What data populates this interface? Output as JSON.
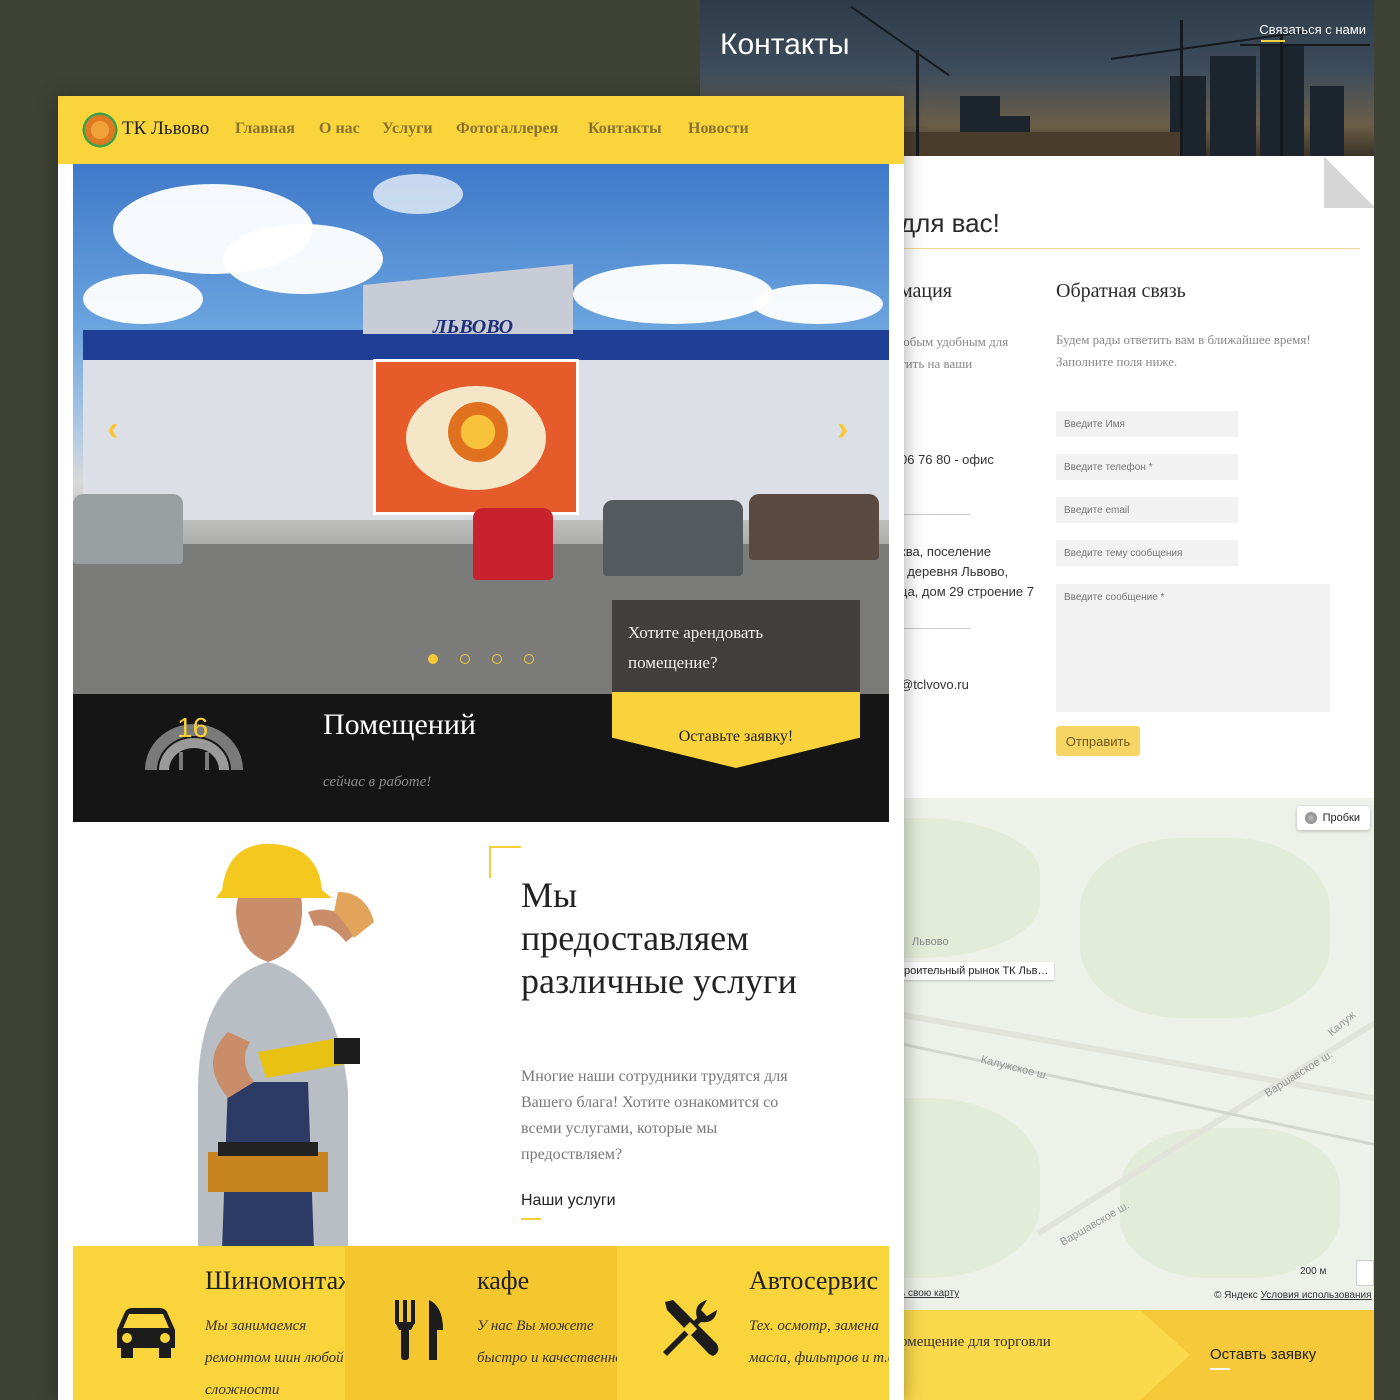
{
  "contacts_page": {
    "banner_title": "Контакты",
    "contact_link": "Связаться с нами",
    "section_heading": "для вас!",
    "info": {
      "title": "мация",
      "text": "юбым удобным для\nтить на ваши",
      "phone": "06 76 80 - офис",
      "address": "ква, поселение\n, деревня Львово,\nца, дом 29 строение 7",
      "email": "@tclvovo.ru"
    },
    "feedback": {
      "title": "Обратная связь",
      "text": "Будем рады ответить вам в ближайшее время! Заполните поля ниже.",
      "name_placeholder": "Введите Имя",
      "phone_placeholder": "Введите телефон *",
      "email_placeholder": "Введите email",
      "subject_placeholder": "Введите тему сообщения",
      "message_placeholder": "Введите сообщение *",
      "submit_label": "Отправить"
    },
    "map": {
      "traffic_label": "Пробки",
      "place_lvovo": "Львово",
      "marker_label": "роительный рынок ТК Льв…",
      "road_kaluzhskoe": "Калужское ш.",
      "road_varshavskoe_1": "Варшавское ш.",
      "road_varshavskoe_2": "Варшавское ш.",
      "road_kaluzh_2": "Калуж",
      "scale": "200 м",
      "own_map": "ь свою карту",
      "copyright_prefix": "© Яндекс",
      "copyright_link": "Условия использования"
    },
    "cta_strip": {
      "text": "омещение для торговли",
      "button": "Оставть заявку"
    }
  },
  "main_page": {
    "logo_text": "ТК Львово",
    "nav": [
      "Главная",
      "О нас",
      "Услуги",
      "Фотогаллерея",
      "Контакты",
      "Новости"
    ],
    "hero": {
      "store_sign": "ЛЬВОВО",
      "rent_question": "Хотите арендовать помещение?",
      "rent_button": "Оставьте заявку!",
      "active_slide": 1,
      "slides_total": 4
    },
    "stats": {
      "number": "16",
      "title": "Помещений",
      "subtitle": "сейчас в работе!"
    },
    "services_intro": {
      "title": "Мы предоставляем различные услуги",
      "text": "Многие наши сотрудники трудятся для Вашего блага! Хотите ознакомится со всеми услугами, которые мы предоствляем?",
      "link": "Наши услуги"
    },
    "services": [
      {
        "title": "Шиномонтаж",
        "text": "Мы занимаемся ремонтом шин любой сложности",
        "icon": "car-icon"
      },
      {
        "title": "кафе",
        "text": "У нас Вы можете быстро и качественно",
        "icon": "fork-knife-icon"
      },
      {
        "title": "Автосервис",
        "text": "Тех. осмотр, замена масла, фильтров и т.д",
        "icon": "tools-icon"
      }
    ]
  },
  "colors": {
    "accent_yellow": "#f9d43a",
    "dark": "#151515",
    "background": "#3e4336"
  }
}
